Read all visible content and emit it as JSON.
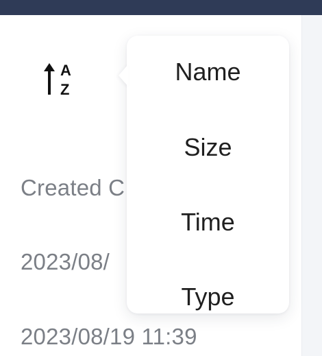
{
  "toolbar": {
    "sort_icon": "sort-ascending-az-icon",
    "sort_icon_letters": [
      "A",
      "Z"
    ]
  },
  "list": {
    "created_label": "Created C",
    "rows": [
      {
        "time": "2023/08/"
      },
      {
        "time": "2023/08/19 11:39"
      }
    ]
  },
  "sort_menu": {
    "items": [
      {
        "label": "Name"
      },
      {
        "label": "Size"
      },
      {
        "label": "Time"
      },
      {
        "label": "Type"
      }
    ]
  },
  "colors": {
    "top_bar": "#2f3b57",
    "menu_text": "#1f1f1f",
    "muted_text": "#7b7f86",
    "popover_bg": "#ffffff"
  }
}
